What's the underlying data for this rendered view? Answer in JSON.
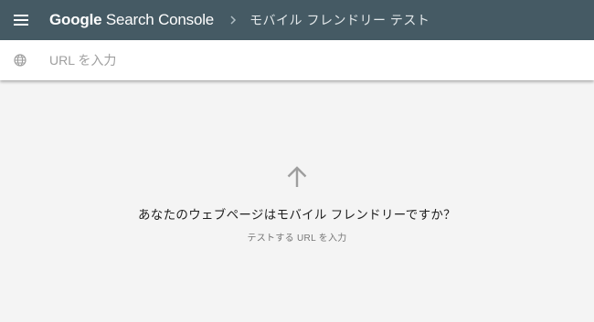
{
  "header": {
    "brand_google": "Google",
    "brand_product": "Search Console",
    "breadcrumb": "モバイル フレンドリー テスト",
    "menu_icon": "hamburger-menu-icon",
    "separator_icon": "chevron-right-icon"
  },
  "url_bar": {
    "icon": "globe-icon",
    "placeholder": "URL を入力",
    "value": ""
  },
  "empty_state": {
    "icon": "arrow-up-icon",
    "title": "あなたのウェブページはモバイル フレンドリーですか？",
    "subtitle": "テストする URL を入力"
  },
  "colors": {
    "header_bg": "#455a64",
    "page_bg": "#f4f4f4",
    "icon_gray": "#9e9e9e"
  }
}
